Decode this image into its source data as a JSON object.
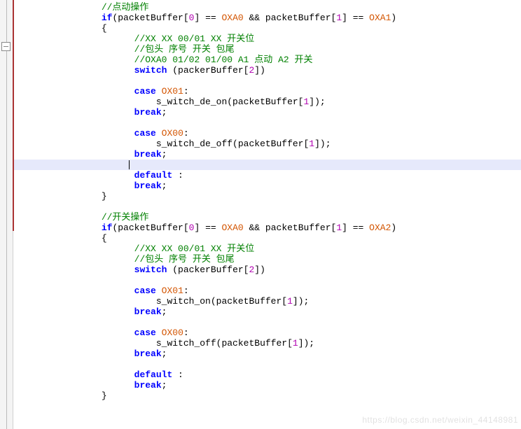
{
  "watermark": "https://blog.csdn.net/weixin_44148981",
  "c": {
    "jog": "//点动操作",
    "if1_a": "if",
    "if1_p": "(packetBuffer[",
    "z0": "0",
    "eq": "] == ",
    "oxa0": "OXA0",
    "amp": " && ",
    "pbuf": "packetBuffer[",
    "one": "1",
    "oxa1": "OXA1",
    "rp": ")",
    "ob": "{",
    "cb": "}",
    "c1a": "//XX XX 00/01 XX 开关位",
    "c1b": "//包头 序号 开关 包尾",
    "c1c": "//OXA0 01/02 01/00 A1 点动 A2 开关",
    "sw": "switch",
    "swarg": " (packerBuffer[",
    "two": "2",
    "swend": "])",
    "case": "case",
    "ox01": "OX01",
    "colon": ":",
    "deon": "s_witch_de_on(packetBuffer[",
    "call_end": "]);",
    "break": "break",
    "semico": ";",
    "ox00": "OX00",
    "deoff": "s_witch_de_off(packetBuffer[",
    "default": "default",
    "dcolon": " :",
    "swop": "//开关操作",
    "oxa2": "OXA2",
    "c2a": "//XX XX 00/01 XX 开关位",
    "c2b": "//包头 序号 开关 包尾",
    "on": "s_witch_on(packetBuffer[",
    "off": "s_witch_off(packetBuffer["
  },
  "chart_data": null
}
